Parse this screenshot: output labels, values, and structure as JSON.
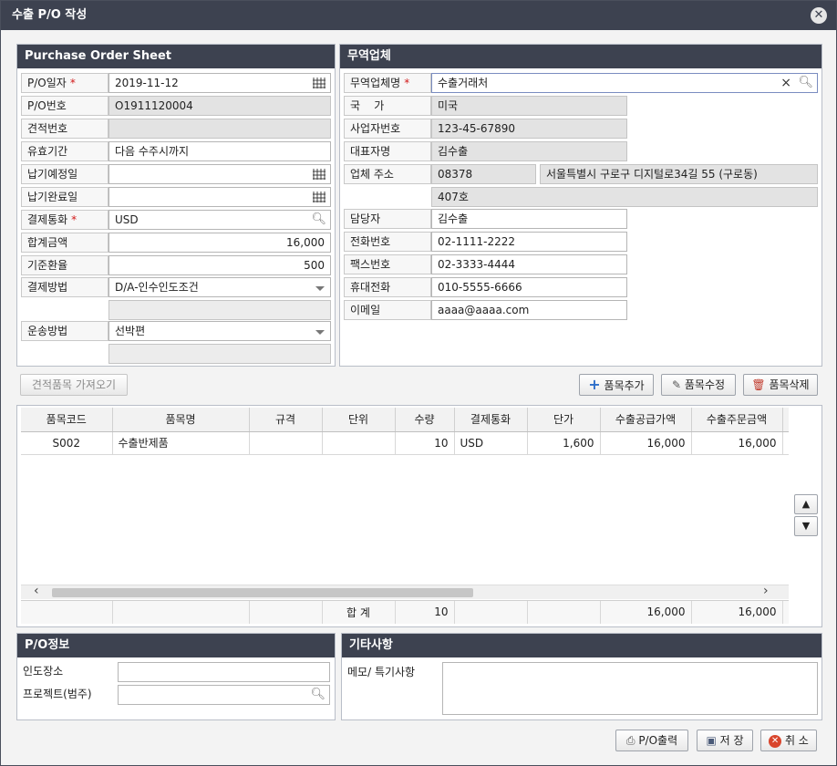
{
  "window": {
    "title": "수출 P/O 작성",
    "close_glyph": "✕"
  },
  "po_sheet": {
    "title": "Purchase Order Sheet",
    "fields": {
      "po_date": {
        "label": "P/O일자",
        "value": "2019-11-12"
      },
      "po_no": {
        "label": "P/O번호",
        "value": "O1911120004"
      },
      "quote_no": {
        "label": "견적번호",
        "value": ""
      },
      "valid_period": {
        "label": "유효기간",
        "value": "다음 수주시까지"
      },
      "delivery_plan": {
        "label": "납기예정일",
        "value": ""
      },
      "delivery_done": {
        "label": "납기완료일",
        "value": ""
      },
      "currency": {
        "label": "결제통화",
        "value": "USD"
      },
      "total_amount": {
        "label": "합계금액",
        "value": "16,000"
      },
      "exchange_rate": {
        "label": "기준환율",
        "value": "500"
      },
      "payment_method": {
        "label": "결제방법",
        "value": "D/A-인수인도조건"
      },
      "shipping_method": {
        "label": "운송방법",
        "value": "선박편"
      }
    },
    "required_mark": "*"
  },
  "trade_partner": {
    "title": "무역업체",
    "fields": {
      "name": {
        "label": "무역업체명",
        "value": "수출거래처"
      },
      "country": {
        "label": "국    가",
        "value": "미국"
      },
      "biz_no": {
        "label": "사업자번호",
        "value": "123-45-67890"
      },
      "ceo": {
        "label": "대표자명",
        "value": "김수출"
      },
      "address": {
        "label": "업체 주소",
        "zip": "08378",
        "addr1": "서울특별시 구로구 디지털로34길 55 (구로동)",
        "addr2": "407호"
      },
      "manager": {
        "label": "담당자",
        "value": "김수출"
      },
      "phone": {
        "label": "전화번호",
        "value": "02-1111-2222"
      },
      "fax": {
        "label": "팩스번호",
        "value": "02-3333-4444"
      },
      "mobile": {
        "label": "휴대전화",
        "value": "010-5555-6666"
      },
      "email": {
        "label": "이메일",
        "value": "aaaa@aaaa.com"
      }
    },
    "clear_glyph": "×"
  },
  "toolbar": {
    "import_quote": "견적품목 가져오기",
    "add_item": "품목추가",
    "edit_item": "품목수정",
    "delete_item": "품목삭제"
  },
  "items_grid": {
    "columns": [
      "품목코드",
      "품목명",
      "규격",
      "단위",
      "수량",
      "결제통화",
      "단가",
      "수출공급가액",
      "수출주문금액"
    ],
    "rows": [
      {
        "code": "S002",
        "name": "수출반제품",
        "spec": "",
        "unit": "",
        "qty": "10",
        "currency": "USD",
        "price": "1,600",
        "supply": "16,000",
        "order": "16,000"
      }
    ],
    "footer": {
      "label": "합 계",
      "qty": "10",
      "supply": "16,000",
      "order": "16,000"
    },
    "move_up": "▲",
    "move_down": "▼"
  },
  "po_info": {
    "title": "P/O정보",
    "delivery_place_label": "인도장소",
    "delivery_place_value": "",
    "project_label": "프로젝트(범주)",
    "project_value": ""
  },
  "etc": {
    "title": "기타사항",
    "memo_label": "메모/ 특기사항",
    "memo_value": ""
  },
  "footer_buttons": {
    "print": "P/O출력",
    "save": "저 장",
    "cancel": "취 소"
  }
}
